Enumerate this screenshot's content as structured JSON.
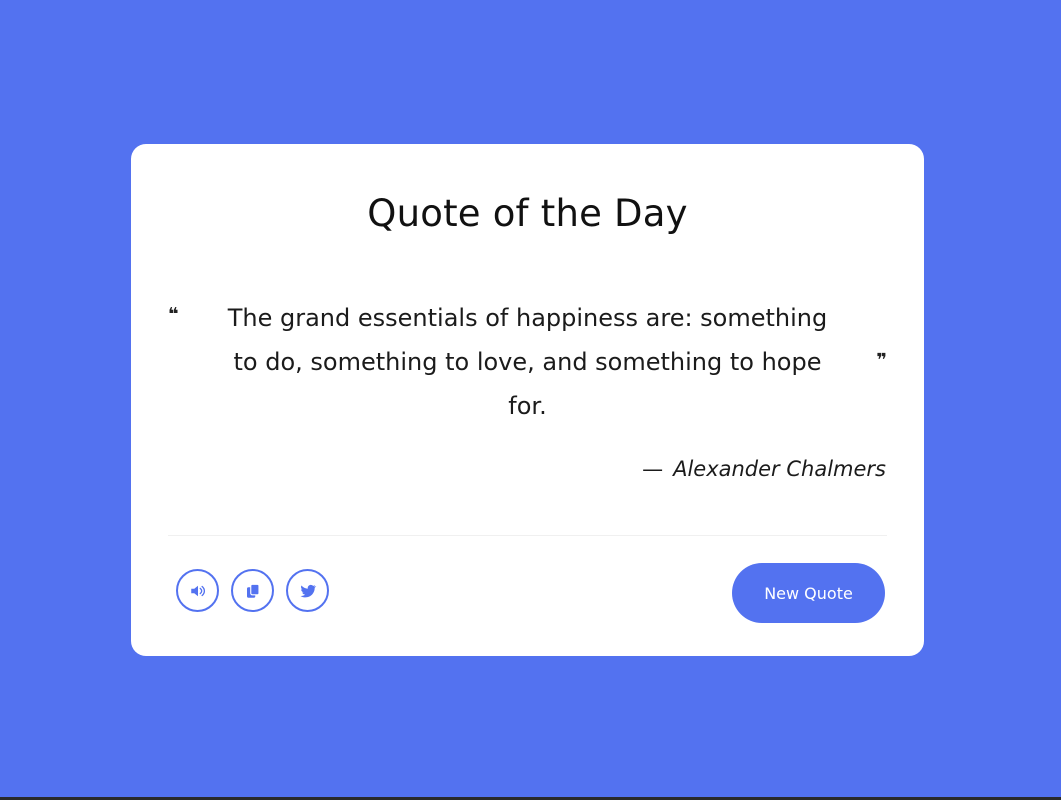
{
  "card": {
    "title": "Quote of the Day",
    "quote": {
      "open_mark": "❝",
      "text": "The grand essentials of happiness are: something to do, something to love, and something to hope for.",
      "close_mark": "❞"
    },
    "author": {
      "dash": "—",
      "name": "Alexander Chalmers"
    },
    "actions": {
      "icons": [
        "speaker-icon",
        "copy-icon",
        "twitter-icon"
      ],
      "new_quote_label": "New Quote"
    }
  },
  "colors": {
    "background": "#5372f0",
    "card": "#ffffff",
    "accent": "#5372f0",
    "text": "#1b1b1b"
  }
}
